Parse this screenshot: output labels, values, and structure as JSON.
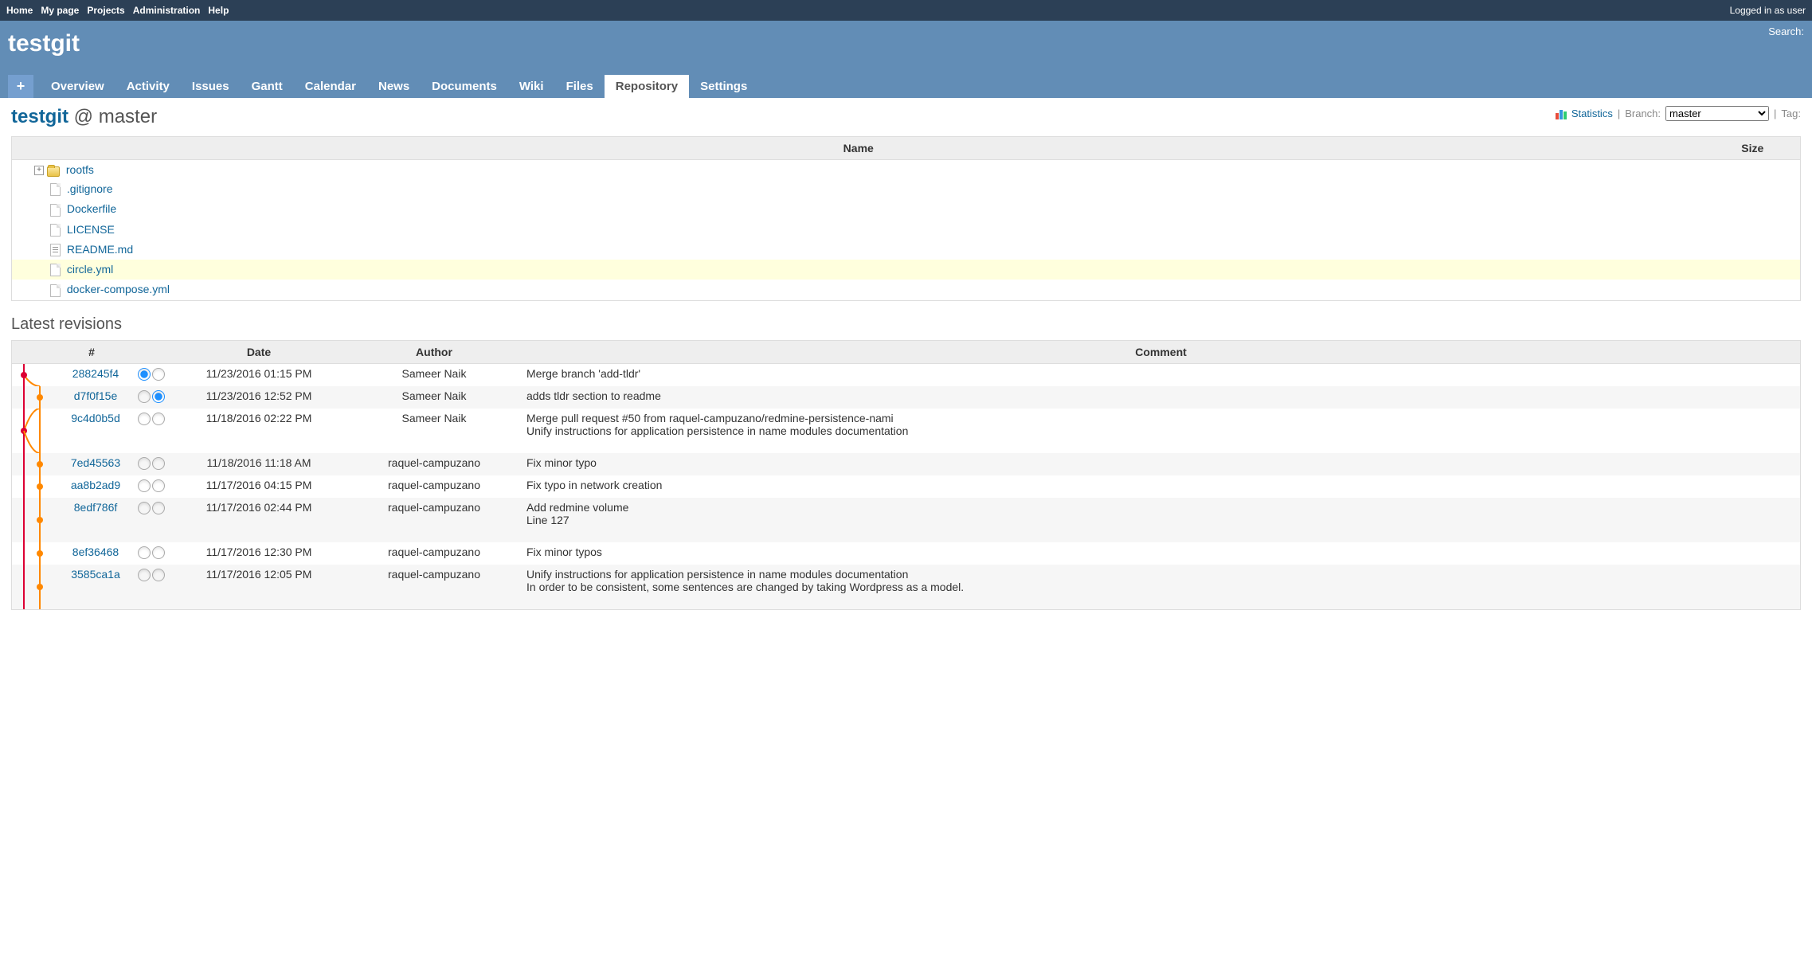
{
  "top_menu": {
    "items": [
      "Home",
      "My page",
      "Projects",
      "Administration",
      "Help"
    ],
    "logged_in": "Logged in as user"
  },
  "header": {
    "project_name": "testgit",
    "search_label": "Search:"
  },
  "main_menu": {
    "new_object": "+",
    "items": [
      {
        "label": "Overview",
        "selected": false
      },
      {
        "label": "Activity",
        "selected": false
      },
      {
        "label": "Issues",
        "selected": false
      },
      {
        "label": "Gantt",
        "selected": false
      },
      {
        "label": "Calendar",
        "selected": false
      },
      {
        "label": "News",
        "selected": false
      },
      {
        "label": "Documents",
        "selected": false
      },
      {
        "label": "Wiki",
        "selected": false
      },
      {
        "label": "Files",
        "selected": false
      },
      {
        "label": "Repository",
        "selected": true
      },
      {
        "label": "Settings",
        "selected": false
      }
    ]
  },
  "contextual": {
    "statistics": "Statistics",
    "branch_label": "Branch:",
    "branch_value": "master",
    "tag_label": "Tag:"
  },
  "title": {
    "project": "testgit",
    "at": "@",
    "branch": "master"
  },
  "entries": {
    "columns": {
      "name": "Name",
      "size": "Size"
    },
    "rows": [
      {
        "name": "rootfs",
        "type": "folder",
        "expander": true
      },
      {
        "name": ".gitignore",
        "type": "file"
      },
      {
        "name": "Dockerfile",
        "type": "file"
      },
      {
        "name": "LICENSE",
        "type": "file"
      },
      {
        "name": "README.md",
        "type": "text"
      },
      {
        "name": "circle.yml",
        "type": "file",
        "highlighted": true
      },
      {
        "name": "docker-compose.yml",
        "type": "file"
      }
    ]
  },
  "revisions": {
    "heading": "Latest revisions",
    "columns": {
      "hash": "#",
      "date": "Date",
      "author": "Author",
      "comment": "Comment"
    },
    "rows": [
      {
        "hash": "288245f4",
        "date": "11/23/2016 01:15 PM",
        "author": "Sameer Naik",
        "comment": "Merge branch 'add-tldr'",
        "r1": true,
        "r2": false
      },
      {
        "hash": "d7f0f15e",
        "date": "11/23/2016 12:52 PM",
        "author": "Sameer Naik",
        "comment": "adds tldr section to readme",
        "r1": false,
        "r2": true
      },
      {
        "hash": "9c4d0b5d",
        "date": "11/18/2016 02:22 PM",
        "author": "Sameer Naik",
        "comment": "Merge pull request #50 from raquel-campuzano/redmine-persistence-nami\nUnify instructions for application persistence in name modules documentation"
      },
      {
        "hash": "7ed45563",
        "date": "11/18/2016 11:18 AM",
        "author": "raquel-campuzano",
        "comment": "Fix minor typo"
      },
      {
        "hash": "aa8b2ad9",
        "date": "11/17/2016 04:15 PM",
        "author": "raquel-campuzano",
        "comment": "Fix typo in network creation"
      },
      {
        "hash": "8edf786f",
        "date": "11/17/2016 02:44 PM",
        "author": "raquel-campuzano",
        "comment": "Add redmine volume\nLine 127"
      },
      {
        "hash": "8ef36468",
        "date": "11/17/2016 12:30 PM",
        "author": "raquel-campuzano",
        "comment": "Fix minor typos"
      },
      {
        "hash": "3585ca1a",
        "date": "11/17/2016 12:05 PM",
        "author": "raquel-campuzano",
        "comment": "Unify instructions for application persistence in name modules documentation\nIn order to be consistent, some sentences are changed by taking Wordpress as a model."
      }
    ]
  }
}
